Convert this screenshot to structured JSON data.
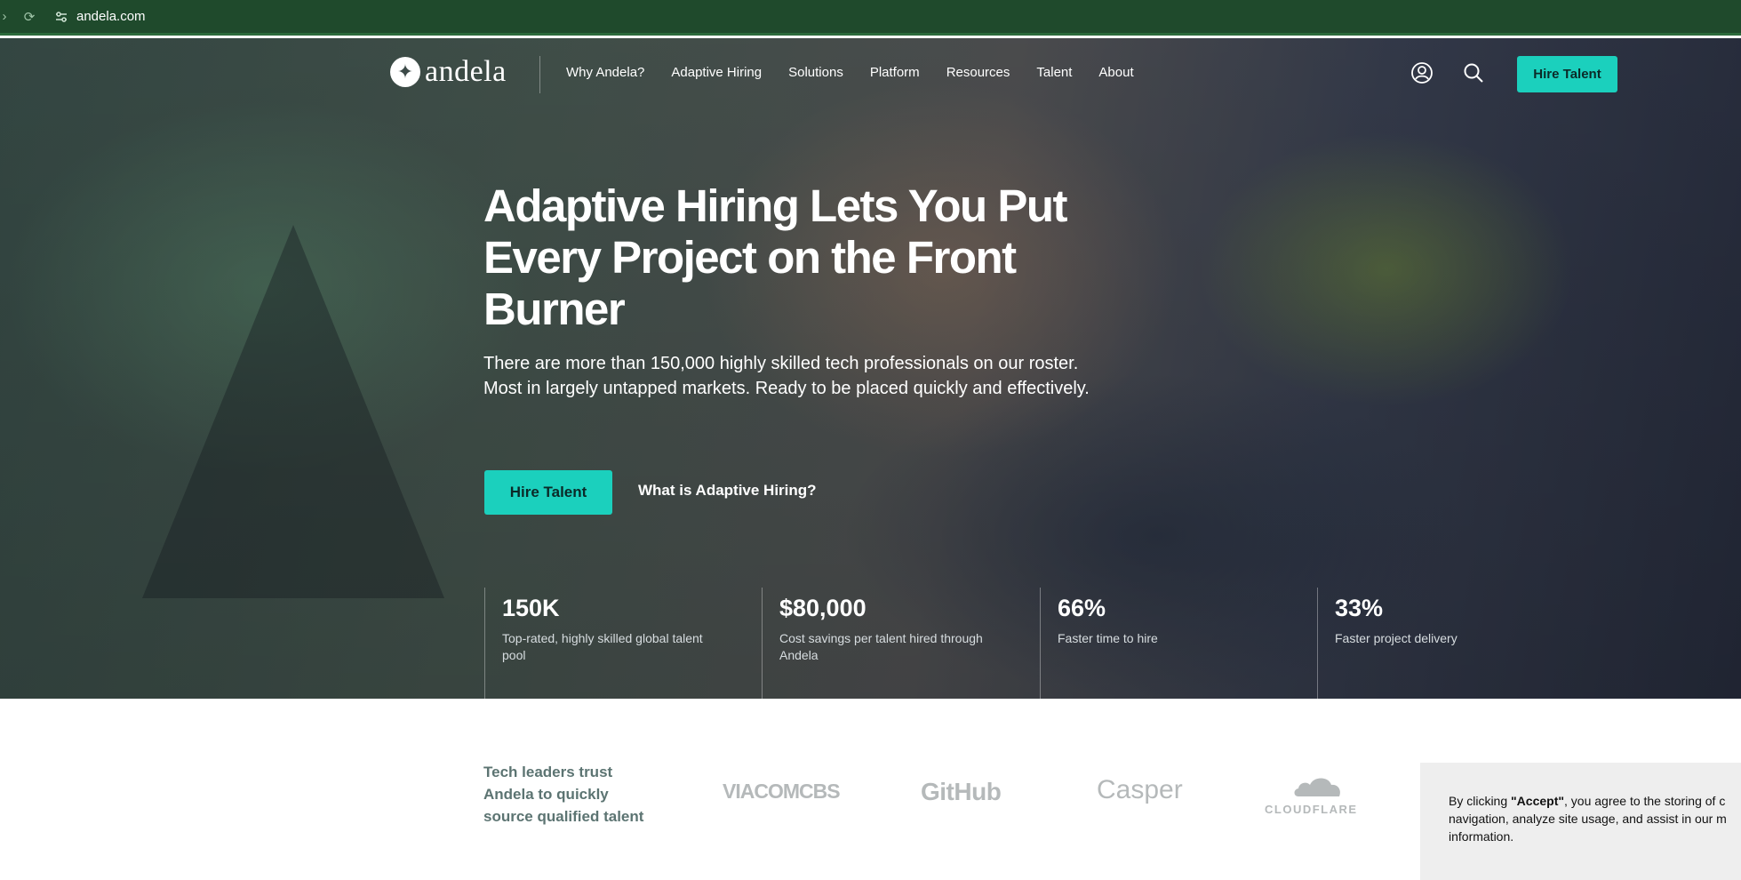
{
  "browser": {
    "url": "andela.com",
    "icons": [
      "forward-icon",
      "reload-icon",
      "site-settings-icon"
    ]
  },
  "header": {
    "logo_text": "andela",
    "nav": [
      "Why Andela?",
      "Adaptive Hiring",
      "Solutions",
      "Platform",
      "Resources",
      "Talent",
      "About"
    ],
    "cta": "Hire Talent"
  },
  "hero": {
    "title": "Adaptive Hiring Lets You Put Every Project on the Front Burner",
    "subtitle": "There are more than 150,000 highly skilled tech professionals on our roster. Most in largely untapped markets. Ready to be placed quickly and effectively.",
    "primary_button": "Hire Talent",
    "secondary_link": "What is Adaptive Hiring?"
  },
  "stats": [
    {
      "value": "150K",
      "label": "Top-rated, highly skilled global talent pool"
    },
    {
      "value": "$80,000",
      "label": "Cost savings per talent hired through Andela"
    },
    {
      "value": "66%",
      "label": "Faster time to hire"
    },
    {
      "value": "33%",
      "label": "Faster project delivery"
    }
  ],
  "trust": {
    "heading": "Tech leaders trust Andela to quickly source qualified talent",
    "logos": [
      "VIACOMCBS",
      "GitHub",
      "Casper",
      "CLOUDFLARE"
    ]
  },
  "cookie": {
    "prefix": "By clicking ",
    "accept": "\"Accept\"",
    "line1_rest": ", you agree to the storing of c",
    "line2": "navigation, analyze site usage, and assist in our m",
    "line3": "information."
  },
  "colors": {
    "accent": "#1bd0bd",
    "browser_bar": "#1f4a2c",
    "trust_text": "#5c7472"
  }
}
